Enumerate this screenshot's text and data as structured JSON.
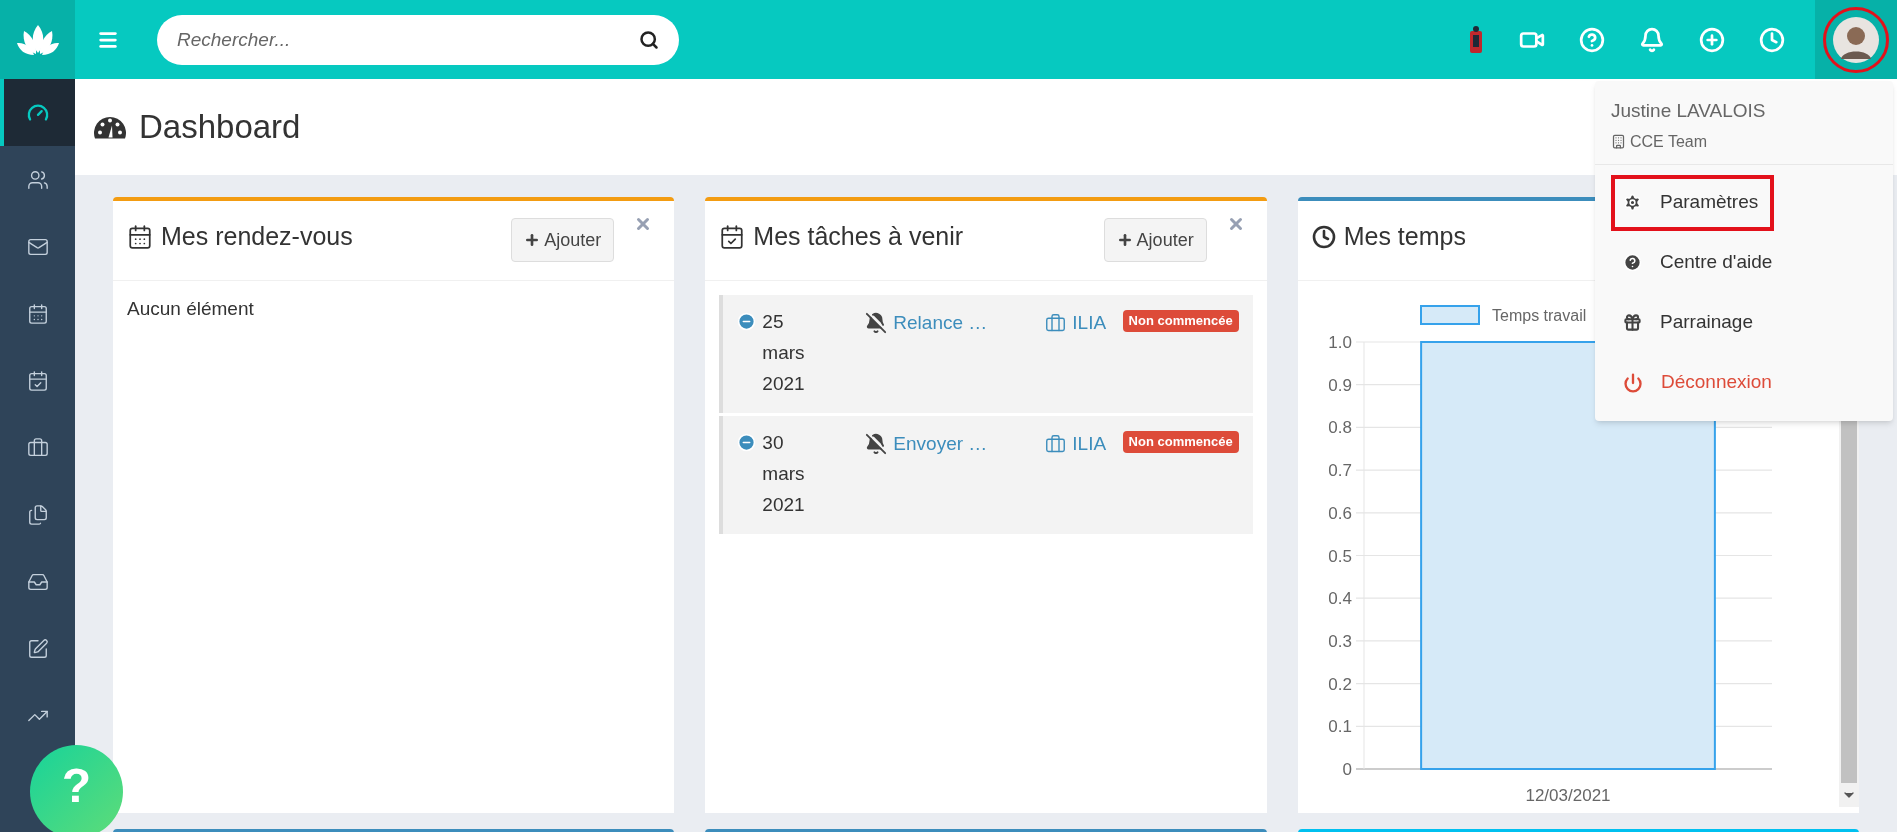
{
  "search": {
    "placeholder": "Rechercher..."
  },
  "topbar_icons": [
    {
      "kind": "figure"
    },
    {
      "kind": "video"
    },
    {
      "kind": "help"
    },
    {
      "kind": "bell"
    },
    {
      "kind": "plus"
    },
    {
      "kind": "clock"
    }
  ],
  "avatar": {
    "highlighted": true
  },
  "sidebar": {
    "items": [
      {
        "kind": "dashboard",
        "selected": true
      },
      {
        "kind": "contacts",
        "selected": false
      },
      {
        "kind": "mail",
        "selected": false
      },
      {
        "kind": "calendar",
        "selected": false
      },
      {
        "kind": "tasks",
        "selected": false
      },
      {
        "kind": "cases",
        "selected": false
      },
      {
        "kind": "documents",
        "selected": false
      },
      {
        "kind": "inbox",
        "selected": false
      },
      {
        "kind": "edit",
        "selected": false
      },
      {
        "kind": "stats",
        "selected": false
      }
    ]
  },
  "help_button": {
    "label": "?"
  },
  "page": {
    "title": "Dashboard"
  },
  "panels": [
    {
      "kind": "appointments",
      "title": "Mes rendez-vous",
      "color": "#f39c12",
      "add_label": "Ajouter",
      "empty_text": "Aucun élément"
    },
    {
      "kind": "tasks",
      "title": "Mes tâches à venir",
      "color": "#f39c12",
      "add_label": "Ajouter",
      "tasks": [
        {
          "date": "25 mars 2021",
          "subject": "Relance …",
          "case": "ILIA",
          "status": "Non commencée"
        },
        {
          "date": "30 mars 2021",
          "subject": "Envoyer …",
          "case": "ILIA",
          "status": "Non commencée"
        }
      ]
    },
    {
      "kind": "times",
      "title": "Mes temps",
      "color": "#3c8dbc",
      "chart_data": {
        "type": "bar",
        "grid": true,
        "categories": [
          "12/03/2021"
        ],
        "series": [
          {
            "name": "Temps travail",
            "color": "#d6eaf8",
            "values": [
              1.0
            ]
          }
        ],
        "ylim": [
          0,
          1
        ],
        "yticks": [
          0,
          0.1,
          0.2,
          0.3,
          0.4,
          0.5,
          0.6,
          0.7,
          0.8,
          0.9,
          {
            "value": 1,
            "label": "1.0"
          }
        ]
      }
    }
  ],
  "bottom_panels": [
    {
      "color": "#3c8dbc"
    },
    {
      "color": "#3c8dbc"
    },
    {
      "color": "#00c0ef"
    }
  ],
  "user_menu": {
    "name": "Justine LAVALOIS",
    "team": "CCE Team",
    "items": [
      {
        "kind": "settings",
        "label": "Paramètres",
        "selected": true
      },
      {
        "kind": "help",
        "label": "Centre d'aide",
        "selected": false
      },
      {
        "kind": "gift",
        "label": "Parrainage",
        "selected": false
      },
      {
        "kind": "logout",
        "label": "Déconnexion",
        "selected": false
      }
    ]
  }
}
